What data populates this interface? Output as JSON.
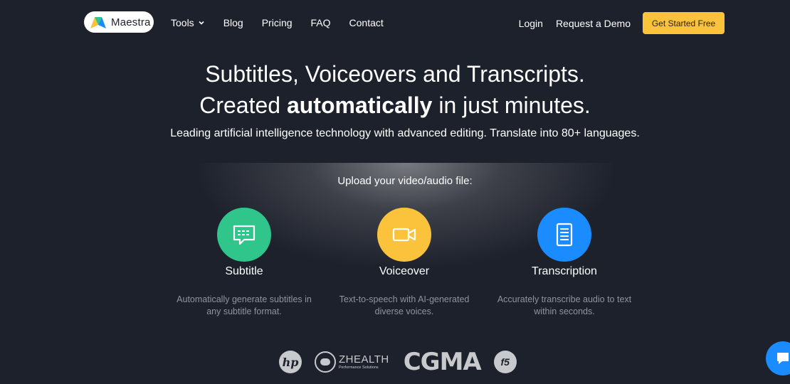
{
  "nav": {
    "brand": "Maestra",
    "links": [
      "Tools",
      "Blog",
      "Pricing",
      "FAQ",
      "Contact"
    ],
    "login": "Login",
    "demo": "Request a Demo",
    "cta": "Get Started Free"
  },
  "hero": {
    "line1": "Subtitles, Voiceovers and Transcripts.",
    "line2_pre": "Created ",
    "line2_bold": "automatically",
    "line2_post": " in just minutes.",
    "subhead": "Leading artificial intelligence technology with advanced editing. Translate into 80+ languages.",
    "upload_label": "Upload your video/audio file:"
  },
  "cards": [
    {
      "title": "Subtitle",
      "desc_line1": "Automatically generate subtitles in",
      "desc_line2": "any subtitle format.",
      "color": "#2fc58b",
      "icon": "subtitle-bubble-icon"
    },
    {
      "title": "Voiceover",
      "desc_line1": "Text-to-speech with AI-generated",
      "desc_line2": "diverse voices.",
      "color": "#fbc23b",
      "icon": "video-camera-icon"
    },
    {
      "title": "Transcription",
      "desc_line1": "Accurately transcribe audio to text",
      "desc_line2": "within seconds.",
      "color": "#1a8cff",
      "icon": "document-icon"
    }
  ],
  "logos": {
    "hp": "hp",
    "zhealth": "ZHEALTH",
    "zhealth_sub": "Performance Solutions",
    "cgma": "CGMA",
    "f5": "f5"
  },
  "colors": {
    "background": "#1d212b",
    "cta": "#fbc23b",
    "muted": "#8e94a0",
    "chat": "#1a8cff"
  }
}
